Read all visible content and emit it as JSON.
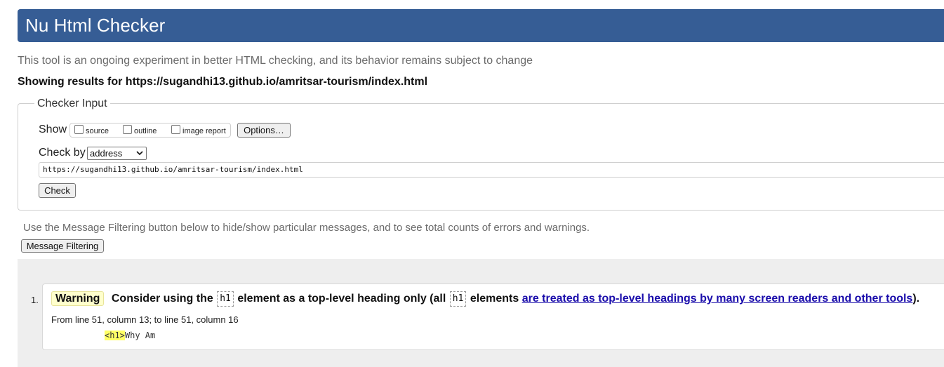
{
  "header": {
    "title": "Nu Html Checker"
  },
  "intro": "This tool is an ongoing experiment in better HTML checking, and its behavior remains subject to change",
  "showing_results": {
    "prefix": "Showing results for",
    "url": "https://sugandhi13.github.io/amritsar-tourism/index.html"
  },
  "checker_input": {
    "legend": "Checker Input",
    "show_label": "Show",
    "show_options": [
      {
        "label": "source",
        "checked": false
      },
      {
        "label": "outline",
        "checked": false
      },
      {
        "label": "image report",
        "checked": false
      }
    ],
    "options_button": "Options…",
    "check_by_label": "Check by",
    "check_by_value": "address",
    "url_value": "https://sugandhi13.github.io/amritsar-tourism/index.html",
    "check_button": "Check"
  },
  "filtering": {
    "note": "Use the Message Filtering button below to hide/show particular messages, and to see total counts of errors and warnings.",
    "button": "Message Filtering"
  },
  "messages": [
    {
      "number": "1.",
      "type": "Warning",
      "text_1": "Consider using the",
      "code_1": "h1",
      "text_2": "element as a top-level heading only (all",
      "code_2": "h1",
      "text_3": "elements",
      "link_text": "are treated as top-level headings by many screen readers and other tools",
      "text_4": ").",
      "location": "From line 51, column 13; to line 51, column 16",
      "extract_highlight": "<h1>",
      "extract_rest": "Why Am"
    }
  ],
  "colors": {
    "header_bg": "#365d95",
    "warning_badge": "#ffffcc",
    "highlight": "#ffff66",
    "link": "#1a0dab"
  }
}
